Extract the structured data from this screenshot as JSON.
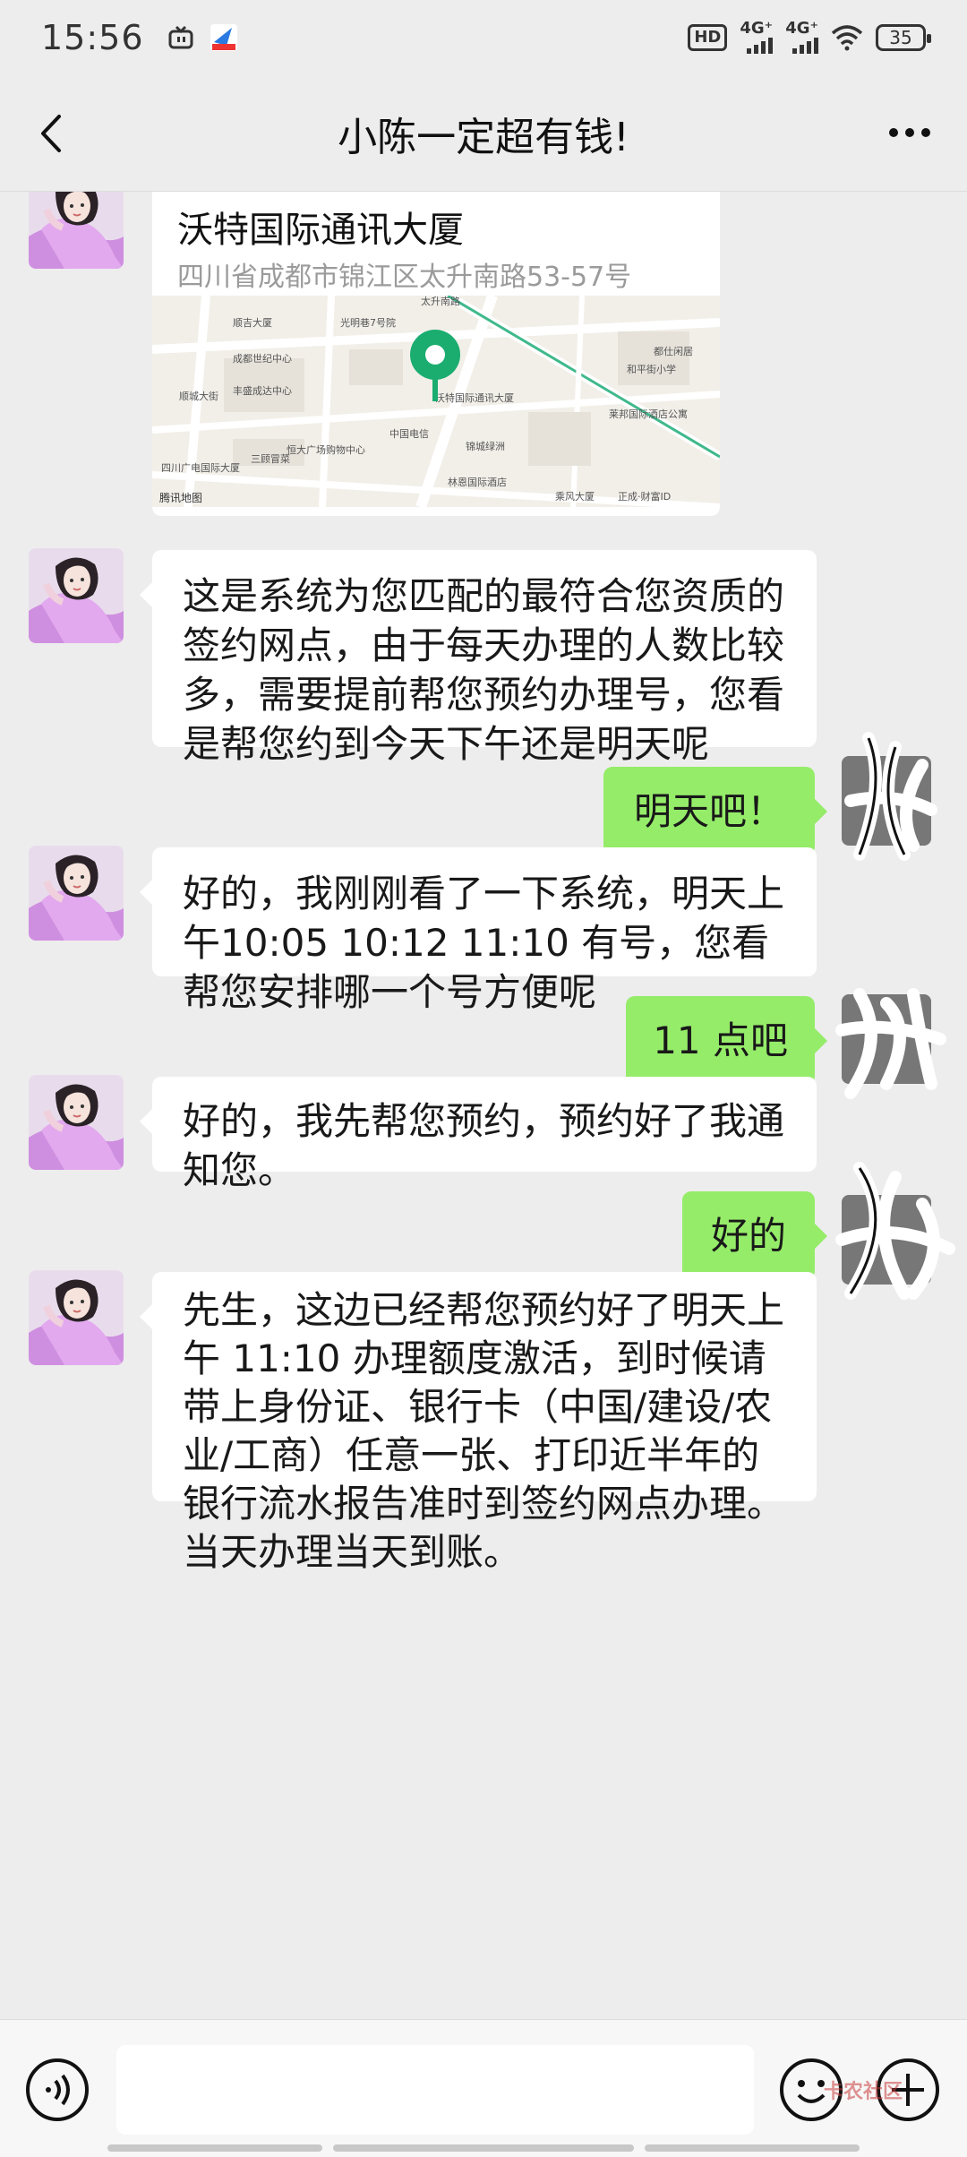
{
  "status_bar": {
    "time": "15:56",
    "hd": "HD",
    "network1": "4G⁺",
    "network2": "4G⁺",
    "battery": "35"
  },
  "nav": {
    "title": "小陈一定超有钱!"
  },
  "location_card": {
    "title": "沃特国际通讯大厦",
    "address": "四川省成都市锦江区太升南路53-57号",
    "map_labels": [
      "顺吉大厦",
      "光明巷7号院",
      "太升南路",
      "成都世纪中心",
      "丰盛成达中心",
      "顺城大街",
      "恒大广场购物中心",
      "中国电信",
      "锦城绿洲",
      "林恩国际酒店",
      "四川广电国际大厦",
      "三顾冒菜",
      "沃特国际通讯大厦",
      "都仕闲居",
      "和平街小学",
      "莱邦国际酒店公寓",
      "乘风大厦",
      "正成·财富ID",
      "腾讯地图"
    ]
  },
  "messages": [
    {
      "side": "left",
      "text": "这是系统为您匹配的最符合您资质的签约网点，由于每天办理的人数比较多，需要提前帮您预约办理号，您看是帮您约到今天下午还是明天呢"
    },
    {
      "side": "right",
      "text": "明天吧！"
    },
    {
      "side": "left",
      "text": "好的，我刚刚看了一下系统，明天上午10:05  10:12  11:10 有号，您看帮您安排哪一个号方便呢"
    },
    {
      "side": "right",
      "text": "11 点吧"
    },
    {
      "side": "left",
      "text": "好的，我先帮您预约，预约好了我通知您。"
    },
    {
      "side": "right",
      "text": "好的"
    },
    {
      "side": "left",
      "text": "先生，这边已经帮您预约好了明天上午 11:10 办理额度激活，到时候请带上身份证、银行卡（中国/建设/农业/工商）任意一张、打印近半年的银行流水报告准时到签约网点办理。当天办理当天到账。"
    }
  ],
  "input_bar": {
    "placeholder": "",
    "watermark": "卡农社区"
  },
  "icons": [
    "back-icon",
    "more-icon",
    "voice-icon",
    "emoji-icon",
    "plus-icon",
    "location-pin-icon"
  ],
  "colors": {
    "background": "#ededed",
    "bubble_self": "#95ec69",
    "bubble_other": "#ffffff",
    "map_pin": "#1aad6f"
  }
}
